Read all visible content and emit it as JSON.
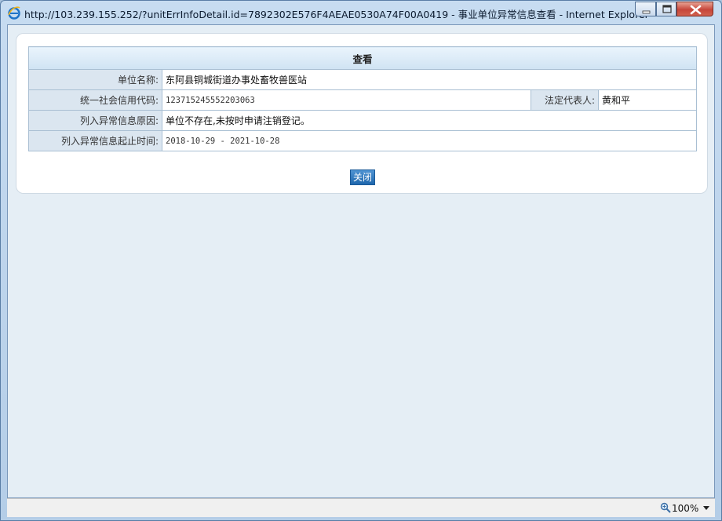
{
  "window": {
    "title": "http://103.239.155.252/?unitErrInfoDetail.id=7892302E576F4AEAE0530A74F00A0419 - 事业单位异常信息查看 - Internet Explorer",
    "icon": "internet-explorer-icon"
  },
  "panel": {
    "header": "查看",
    "rows": {
      "unit_name_label": "单位名称:",
      "unit_name_value": "东阿县铜城街道办事处畜牧兽医站",
      "credit_code_label": "统一社会信用代码:",
      "credit_code_value": "123715245552203063",
      "legal_rep_label": "法定代表人:",
      "legal_rep_value": "黄和平",
      "reason_label": "列入异常信息原因:",
      "reason_value": "单位不存在,未按时申请注销登记。",
      "period_label": "列入异常信息起止时间:",
      "period_value": "2018-10-29 - 2021-10-28"
    },
    "close_button": "关闭"
  },
  "statusbar": {
    "zoom": "100%"
  },
  "colors": {
    "close_button": "#2a74bb",
    "label_cell": "#dbe6f0",
    "client_bg": "#e5eef5"
  }
}
